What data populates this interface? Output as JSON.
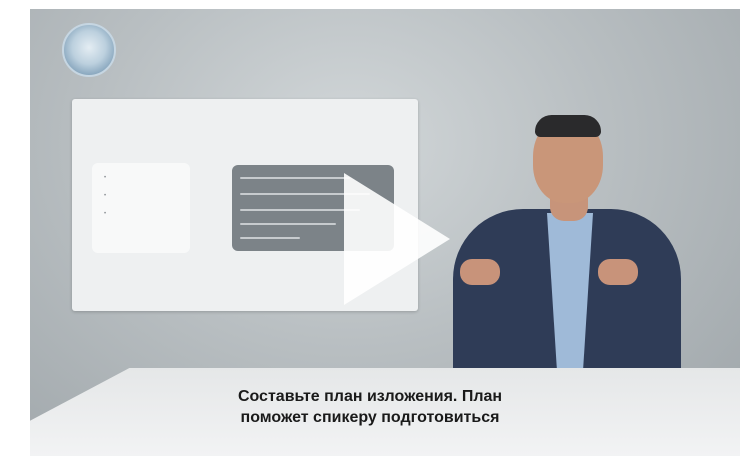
{
  "video": {
    "logo_caption": "",
    "brand": "",
    "slide": {
      "title": "",
      "left_items": [
        "",
        "",
        ""
      ],
      "right_lines": 5
    },
    "subtitle": {
      "line1": "Составьте план изложения. План",
      "line2": "поможет спикеру подготовиться"
    },
    "play_icon": "play-icon",
    "colors": {
      "accent_green": "#3fae4e",
      "play": "#ffffff"
    }
  }
}
